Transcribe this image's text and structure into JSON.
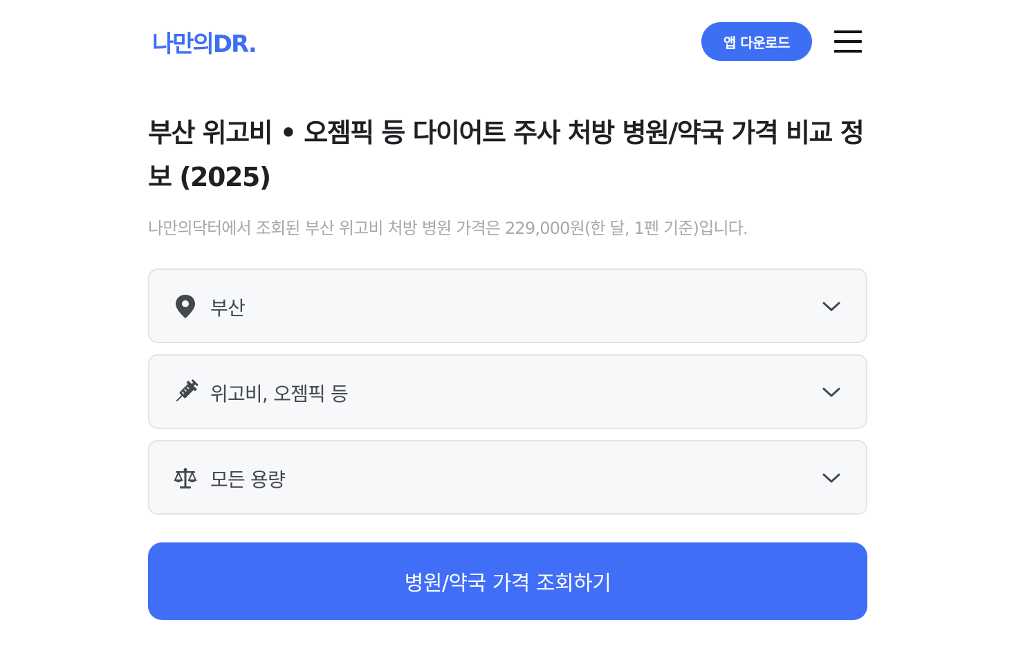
{
  "header": {
    "logo_text": "나만의DR.",
    "download_label": "앱 다운로드",
    "menu_icon": "hamburger-menu-icon"
  },
  "main": {
    "title": "부산 위고비 • 오젬픽 등 다이어트 주사 처방 병원/약국 가격 비교 정보 (2025)",
    "subtitle": "나만의닥터에서 조회된 부산 위고비 처방 병원 가격은 229,000원(한 달, 1펜 기준)입니다."
  },
  "filters": {
    "region": {
      "icon": "location-pin-icon",
      "value": "부산"
    },
    "medicine": {
      "icon": "syringe-icon",
      "value": "위고비, 오젬픽 등"
    },
    "dose": {
      "icon": "scale-icon",
      "value": "모든 용량"
    }
  },
  "submit_label": "병원/약국 가격 조회하기",
  "colors": {
    "brand": "#3d6ff5",
    "button": "#406ef7",
    "subtitle_text": "#a5a8ad",
    "select_bg": "#f7f8f9",
    "select_border": "#e2e4e7"
  }
}
